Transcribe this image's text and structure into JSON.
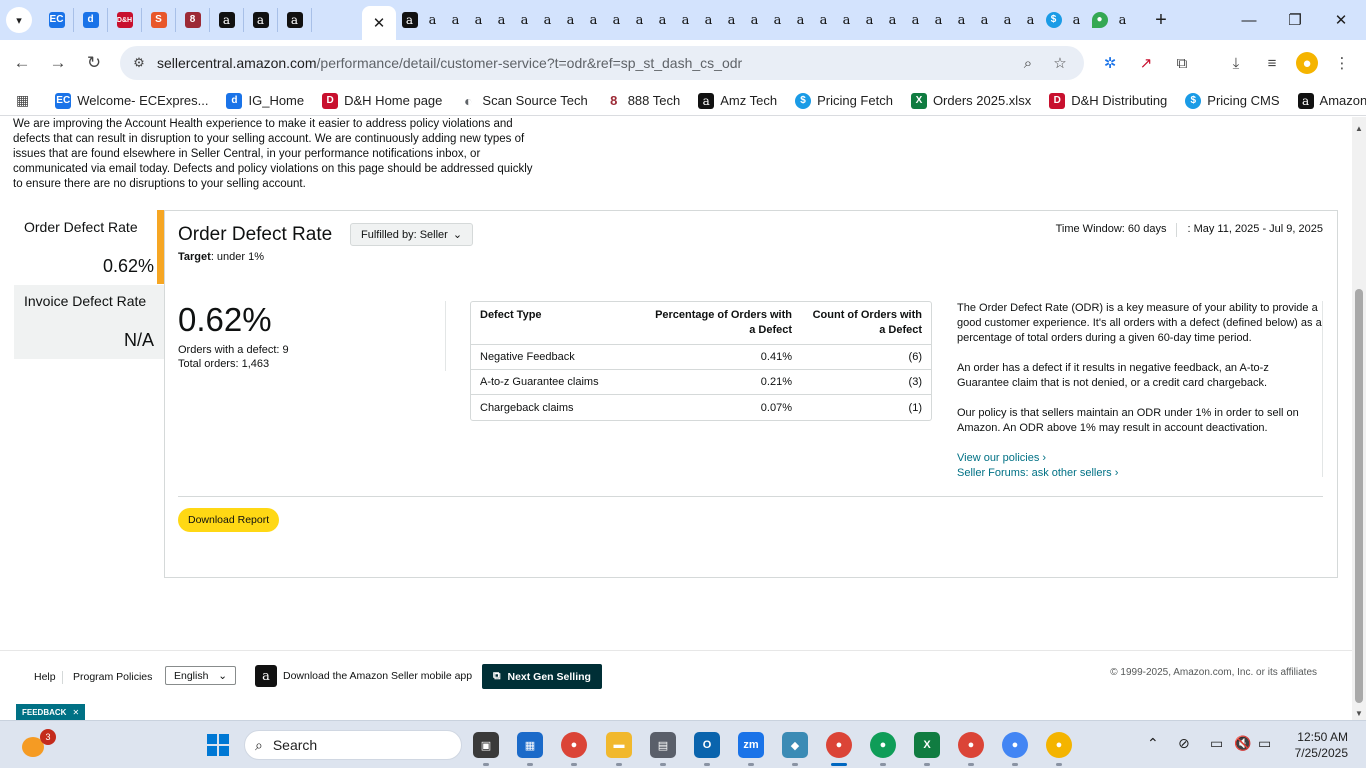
{
  "browser": {
    "close_tab_glyph": "✕",
    "url_host": "sellercentral.amazon.com",
    "url_path": "/performance/detail/customer-service?t=odr&ref=sp_st_dash_cs_odr",
    "pinned_tabs": [
      {
        "icon": "ec-logo-icon",
        "glyph": "EC",
        "color": "#1a73e8"
      },
      {
        "icon": "ig-logo-icon",
        "glyph": "d",
        "color": "#1a73e8"
      },
      {
        "icon": "dh-logo-icon",
        "glyph": "D&H",
        "color": "#c8102e"
      },
      {
        "icon": "scan-source-icon",
        "glyph": "S",
        "color": "#e8572a"
      },
      {
        "icon": "888-tech-icon",
        "glyph": "8",
        "color": "#9c2a36"
      },
      {
        "icon": "amazon-icon",
        "glyph": "a",
        "color": "#111111"
      },
      {
        "icon": "amazon-icon",
        "glyph": "a",
        "color": "#111111"
      },
      {
        "icon": "amazon-icon",
        "glyph": "a",
        "color": "#111111"
      }
    ],
    "tab_glyph": "a",
    "more_tabs_count": 32
  },
  "bookmarks": [
    {
      "label": "Welcome- ECExpres...",
      "icon": "ec-logo-icon",
      "glyph": "EC",
      "color": "#1a73e8"
    },
    {
      "label": "IG_Home",
      "icon": "ig-logo-icon",
      "glyph": "d",
      "color": "#1a73e8"
    },
    {
      "label": "D&H Home page",
      "icon": "dh-logo-icon",
      "glyph": "D",
      "color": "#c8102e"
    },
    {
      "label": "Scan Source Tech",
      "icon": "globe-icon",
      "glyph": "◐",
      "color": "#5f6368"
    },
    {
      "label": "888 Tech",
      "icon": "888-tech-icon",
      "glyph": "8",
      "color": "#9c2a36"
    },
    {
      "label": "Amz Tech",
      "icon": "amazon-icon",
      "glyph": "a",
      "color": "#111111"
    },
    {
      "label": "Pricing Fetch",
      "icon": "pricing-icon",
      "glyph": "$",
      "color": "#1a9be6"
    },
    {
      "label": "Orders 2025.xlsx",
      "icon": "excel-icon",
      "glyph": "X",
      "color": "#107c41"
    },
    {
      "label": "D&H Distributing",
      "icon": "dh-logo-icon",
      "glyph": "D",
      "color": "#c8102e"
    },
    {
      "label": "Pricing CMS",
      "icon": "pricing-icon",
      "glyph": "$",
      "color": "#1a9be6"
    },
    {
      "label": "Amazon",
      "icon": "amazon-icon",
      "glyph": "a",
      "color": "#111111"
    }
  ],
  "intro_text": "We are improving the Account Health experience to make it easier to address policy violations and defects that can result in disruption to your selling account. We are continuously adding new types of issues that are found elsewhere in Seller Central, in your performance notifications inbox, or communicated via email today. Defects and policy violations on this page should be addressed quickly to ensure there are no disruptions to your selling account.",
  "sidebar": [
    {
      "title": "Order Defect Rate",
      "value": "0.62%"
    },
    {
      "title": "Invoice Defect Rate",
      "value": "N/A"
    }
  ],
  "card": {
    "title": "Order Defect Rate",
    "fulfilled_by": "Fulfilled by: Seller",
    "target_label": "Target",
    "target_value": ": under 1%",
    "time_window": "Time Window: 60 days",
    "date_range": ": May 11, 2025 - Jul 9, 2025",
    "rate": "0.62%",
    "orders_with_defect": "Orders with a defect: 9",
    "total_orders": "Total orders: 1,463",
    "table": {
      "headers": [
        "Defect Type",
        "Percentage of Orders with a Defect",
        "Count of Orders with a Defect"
      ],
      "rows": [
        [
          "Negative Feedback",
          "0.41%",
          "(6)"
        ],
        [
          "A-to-z Guarantee claims",
          "0.21%",
          "(3)"
        ],
        [
          "Chargeback claims",
          "0.07%",
          "(1)"
        ]
      ]
    },
    "description": [
      "The Order Defect Rate (ODR) is a key measure of your ability to provide a good customer experience. It's all orders with a defect (defined below) as a percentage of total orders during a given 60-day time period.",
      "An order has a defect if it results in negative feedback, an A-to-z Guarantee claim that is not denied, or a credit card chargeback.",
      "Our policy is that sellers maintain an ODR under 1% in order to sell on Amazon. An ODR above 1% may result in account deactivation."
    ],
    "links": [
      "View our policies ›",
      "Seller Forums: ask other sellers ›"
    ],
    "download_label": "Download Report"
  },
  "footer": {
    "help": "Help",
    "program_policies": "Program Policies",
    "language": "English",
    "mobile_app": "Download the Amazon Seller mobile app",
    "next_gen": "Next Gen Selling",
    "copyright": "© 1999-2025, Amazon.com, Inc. or its affiliates",
    "feedback": "FEEDBACK"
  },
  "taskbar": {
    "search_placeholder": "Search",
    "weather_badge": "3",
    "time": "12:50 AM",
    "date": "7/25/2025",
    "apps": [
      {
        "icon": "file-explorer-dark-icon",
        "glyph": "▣",
        "color": "#3a3a3a"
      },
      {
        "icon": "microsoft-store-icon",
        "glyph": "▦",
        "color": "#1b6ac9"
      },
      {
        "icon": "chrome-icon",
        "glyph": "●",
        "color": "#db4437"
      },
      {
        "icon": "folder-icon",
        "glyph": "▬",
        "color": "#f1b82d"
      },
      {
        "icon": "calculator-icon",
        "glyph": "▤",
        "color": "#5a5f6a"
      },
      {
        "icon": "outlook-icon",
        "glyph": "O",
        "color": "#0a64ad"
      },
      {
        "icon": "zoom-icon",
        "glyph": "zm",
        "color": "#1a73e8"
      },
      {
        "icon": "app-diamond-icon",
        "glyph": "◆",
        "color": "#3b8bb5"
      },
      {
        "icon": "chrome-profile-icon",
        "glyph": "●",
        "color": "#db4437"
      },
      {
        "icon": "chrome-profile-icon",
        "glyph": "●",
        "color": "#0f9d58"
      },
      {
        "icon": "excel-icon",
        "glyph": "X",
        "color": "#107c41"
      },
      {
        "icon": "chrome-profile-icon",
        "glyph": "●",
        "color": "#db4437"
      },
      {
        "icon": "chrome-profile-icon",
        "glyph": "●",
        "color": "#4285f4"
      },
      {
        "icon": "chrome-profile-icon",
        "glyph": "●",
        "color": "#f4b400"
      }
    ]
  }
}
